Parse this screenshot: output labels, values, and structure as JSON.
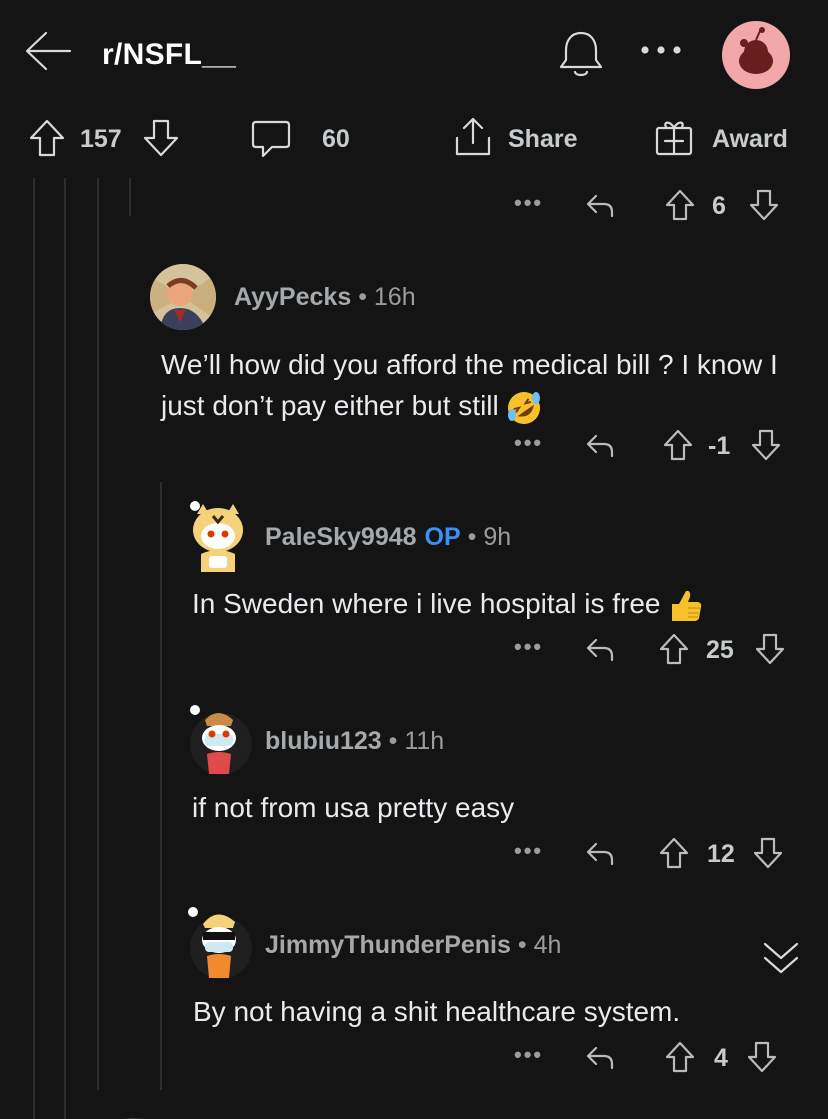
{
  "header": {
    "subreddit": "r/NSFL__"
  },
  "post_actions": {
    "upvotes": "157",
    "comments": "60",
    "share_label": "Share",
    "award_label": "Award"
  },
  "top_row": {
    "score": "6"
  },
  "comments": [
    {
      "username": "AyyPecks",
      "age": "16h",
      "op": "",
      "text": "We’ll how did you afford the medical bill ? I know I just don’t pay either but still",
      "emoji": "rolling-on-floor-laughing-emoji",
      "score": "-1"
    },
    {
      "username": "PaleSky9948",
      "age": "9h",
      "op": "OP",
      "text": "In Sweden where i live hospital is free",
      "emoji": "thumbs-up-emoji",
      "score": "25"
    },
    {
      "username": "blubiu123",
      "age": "11h",
      "op": "",
      "text": "if not from usa pretty easy",
      "score": "12"
    },
    {
      "username": "JimmyThunderPenis",
      "age": "4h",
      "op": "",
      "text": "By not having a shit healthcare system.",
      "score": "4"
    }
  ],
  "separator": "•",
  "more": "•••",
  "colors": {
    "background": "#141414",
    "op_badge": "#3d8ef5",
    "text": "#e8eaed"
  }
}
